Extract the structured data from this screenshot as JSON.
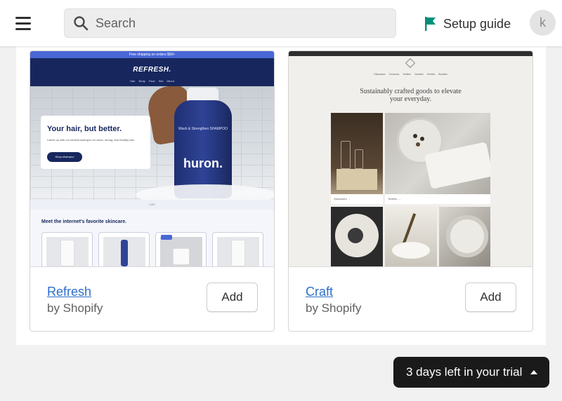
{
  "topbar": {
    "search_placeholder": "Search",
    "setup_guide": "Setup guide",
    "avatar_initial": "k"
  },
  "themes": [
    {
      "name": "Refresh",
      "author": "by Shopify",
      "add_label": "Add",
      "preview": {
        "announcement": "Free shipping on orders $50+",
        "logo": "REFRESH.",
        "nav": "Hair Body Face Kits About",
        "hero_title": "Your hair, but better.",
        "hero_text": "Lather up with our newest shampoo for clean, strong, and healthy hair.",
        "hero_button": "Shop shampoo",
        "bottle_small": "Wash & Strengthen SHAMPOO",
        "bottle_brand": "huron.",
        "pagination": "‹ 1/3 ›",
        "section_title": "Meet the internet's favorite skincare."
      }
    },
    {
      "name": "Craft",
      "author": "by Shopify",
      "add_label": "Add",
      "preview": {
        "nav": "Glassware Ceramics Textiles Candles Textiles Bundles",
        "title_line1": "Sustainably crafted goods to elevate",
        "title_line2": "your everyday.",
        "tile1_caption": "Glassware →",
        "tile2_caption": "Textiles →"
      }
    }
  ],
  "trial": {
    "text": "3 days left in your trial"
  },
  "colors": {
    "link": "#2c6ecb",
    "flag": "#008f7a",
    "trial_bg": "#1a1a1a"
  }
}
